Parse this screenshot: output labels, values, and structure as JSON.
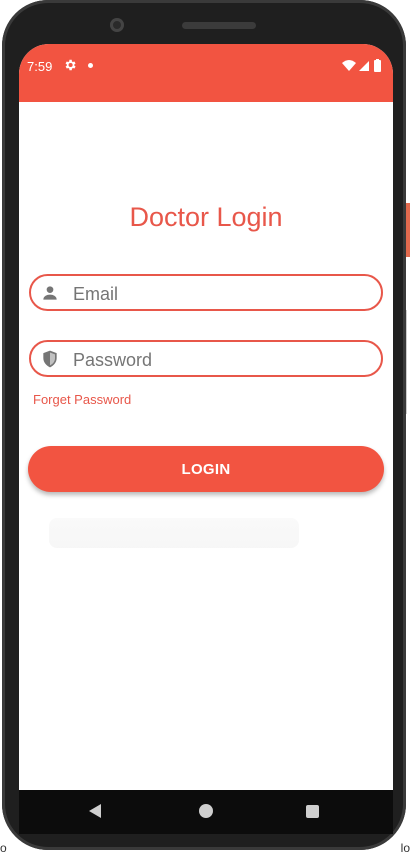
{
  "status_bar": {
    "time": "7:59",
    "icons": [
      "gear-icon",
      "notification-dot-icon",
      "wifi-icon",
      "signal-icon",
      "battery-icon"
    ],
    "color": "#F25441"
  },
  "login": {
    "title": "Doctor Login",
    "email_placeholder": "Email",
    "password_placeholder": "Password",
    "forgot_label": "Forget Password",
    "login_button": "LOGIN"
  },
  "colors": {
    "accent": "#F25441",
    "text_accent": "#E8574A"
  },
  "background_page": {
    "left_fragment": "o",
    "right_fragment": "lo"
  }
}
